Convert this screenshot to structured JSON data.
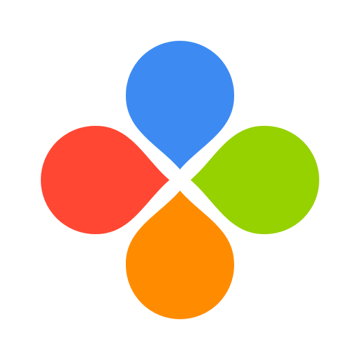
{
  "logo": {
    "petals": [
      {
        "name": "top",
        "color": "#3D8BF2"
      },
      {
        "name": "right",
        "color": "#96D100"
      },
      {
        "name": "bottom",
        "color": "#FF8C00"
      },
      {
        "name": "left",
        "color": "#FF4733"
      }
    ]
  }
}
